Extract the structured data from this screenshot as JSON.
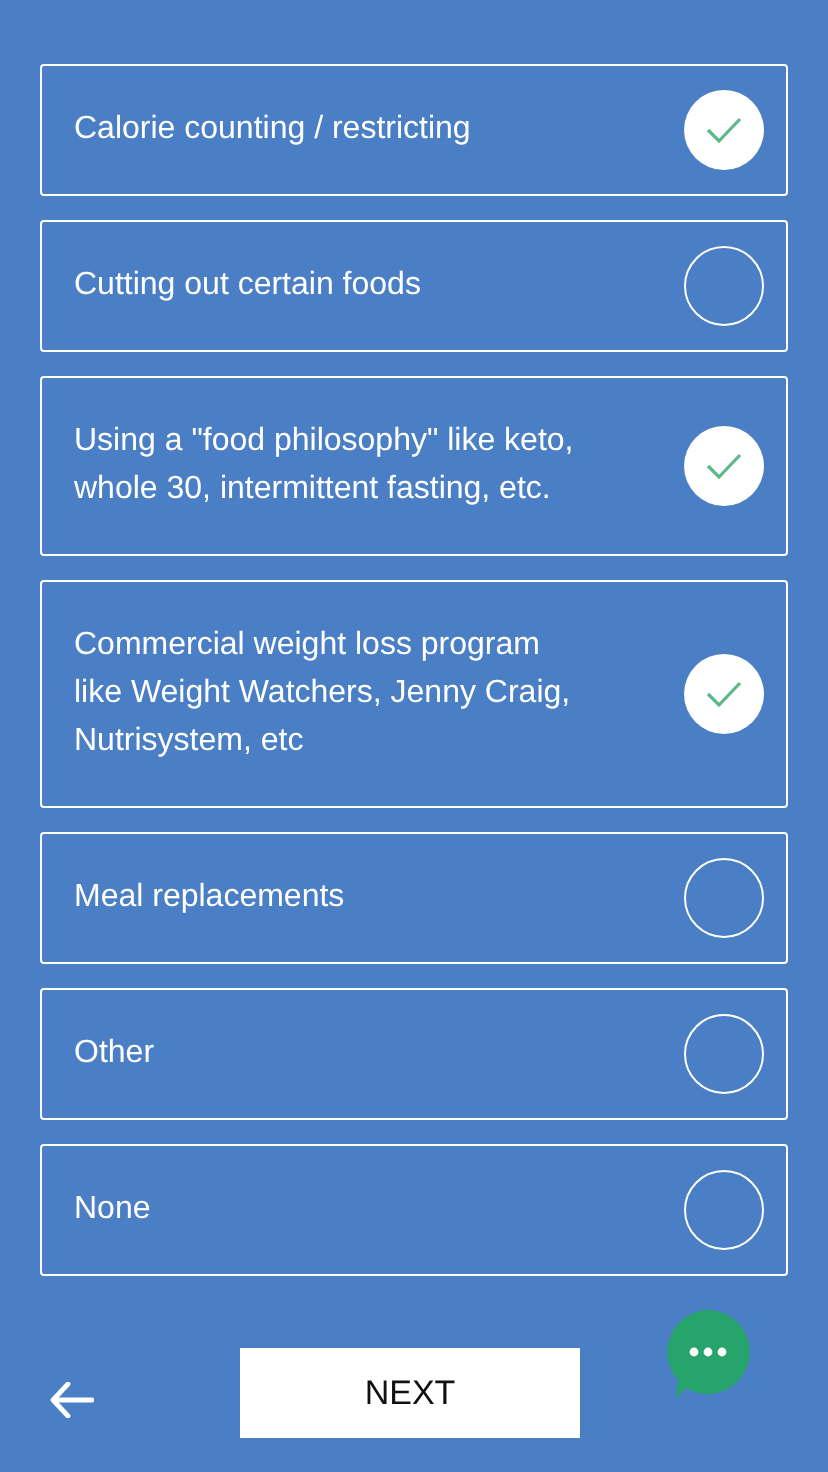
{
  "options": [
    {
      "lines": [
        "Calorie counting / restricting"
      ],
      "checked": true
    },
    {
      "lines": [
        "Cutting out certain foods"
      ],
      "checked": false
    },
    {
      "lines": [
        "Using a \"food philosophy\" like keto,",
        "whole 30, intermittent fasting, etc."
      ],
      "checked": true
    },
    {
      "lines": [
        "Commercial weight loss program",
        "like Weight Watchers, Jenny Craig,",
        "Nutrisystem, etc"
      ],
      "checked": true
    },
    {
      "lines": [
        "Meal replacements"
      ],
      "checked": false
    },
    {
      "lines": [
        "Other"
      ],
      "checked": false
    },
    {
      "lines": [
        "None"
      ],
      "checked": false
    }
  ],
  "next_button": "NEXT"
}
